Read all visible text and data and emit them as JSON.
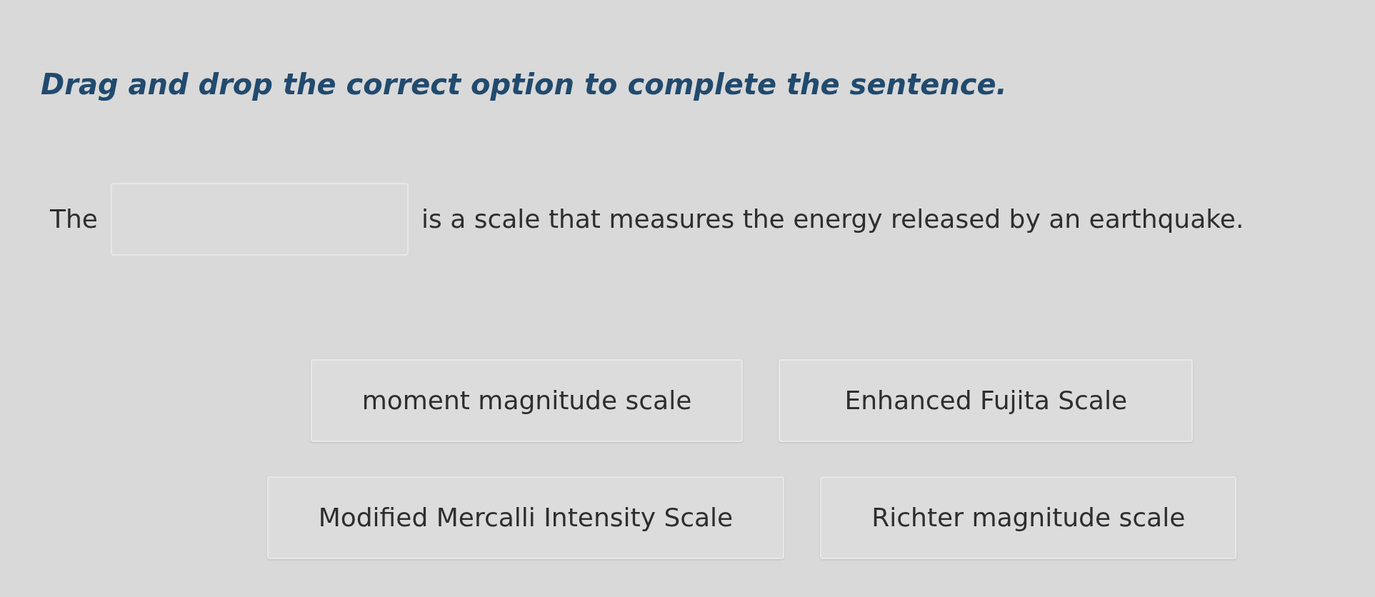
{
  "instruction": "Drag and drop the correct option to complete the sentence.",
  "sentence": {
    "before": "The",
    "after": "is a scale that measures the energy released by an earthquake."
  },
  "option_rows": [
    {
      "options": [
        "moment magnitude scale",
        "Enhanced Fujita Scale"
      ]
    },
    {
      "options": [
        "Modified Mercalli Intensity Scale",
        "Richter magnitude scale"
      ]
    }
  ]
}
